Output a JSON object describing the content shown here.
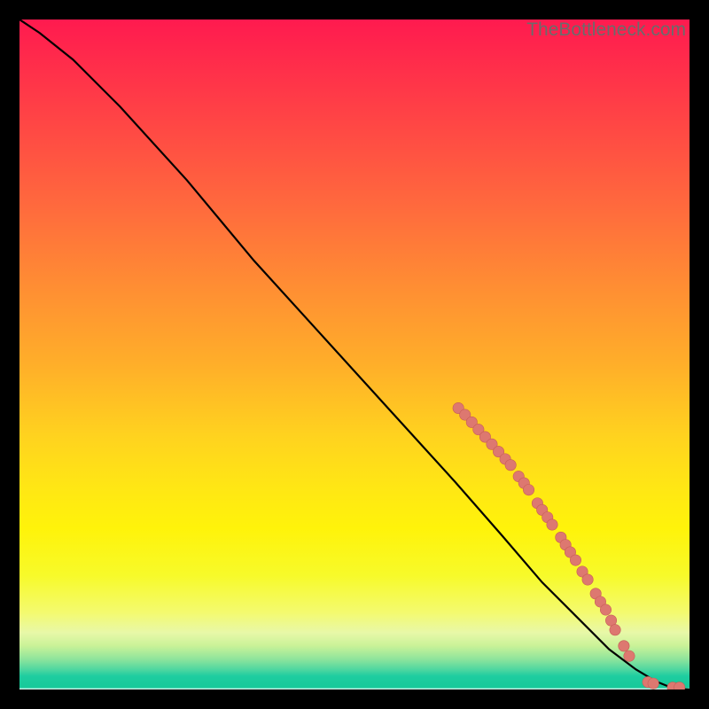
{
  "watermark": "TheBottleneck.com",
  "colors": {
    "background": "#000000",
    "curve": "#000000",
    "marker": "#dd7870",
    "marker_stroke": "#c75d56"
  },
  "chart_data": {
    "type": "line",
    "title": "",
    "xlabel": "",
    "ylabel": "",
    "xlim": [
      0,
      100
    ],
    "ylim": [
      0,
      100
    ],
    "series": [
      {
        "name": "curve",
        "x": [
          0,
          3,
          8,
          15,
          25,
          35,
          45,
          55,
          65,
          72,
          78,
          83,
          88,
          92,
          95,
          97,
          98.5,
          100
        ],
        "y": [
          100,
          98,
          94,
          87,
          76,
          64,
          53,
          42,
          31,
          23,
          16,
          11,
          6,
          3,
          1.2,
          0.4,
          0.1,
          0
        ]
      }
    ],
    "markers": [
      {
        "x": 65.5,
        "y": 42.0
      },
      {
        "x": 66.5,
        "y": 41.0
      },
      {
        "x": 67.5,
        "y": 39.9
      },
      {
        "x": 68.5,
        "y": 38.8
      },
      {
        "x": 69.5,
        "y": 37.7
      },
      {
        "x": 70.5,
        "y": 36.6
      },
      {
        "x": 71.5,
        "y": 35.5
      },
      {
        "x": 72.5,
        "y": 34.4
      },
      {
        "x": 73.3,
        "y": 33.5
      },
      {
        "x": 74.5,
        "y": 31.8
      },
      {
        "x": 75.3,
        "y": 30.8
      },
      {
        "x": 76.0,
        "y": 29.8
      },
      {
        "x": 77.3,
        "y": 27.8
      },
      {
        "x": 78.0,
        "y": 26.8
      },
      {
        "x": 78.8,
        "y": 25.7
      },
      {
        "x": 79.5,
        "y": 24.6
      },
      {
        "x": 80.8,
        "y": 22.7
      },
      {
        "x": 81.5,
        "y": 21.6
      },
      {
        "x": 82.2,
        "y": 20.5
      },
      {
        "x": 83.0,
        "y": 19.3
      },
      {
        "x": 84.0,
        "y": 17.6
      },
      {
        "x": 84.8,
        "y": 16.4
      },
      {
        "x": 86.0,
        "y": 14.3
      },
      {
        "x": 86.7,
        "y": 13.1
      },
      {
        "x": 87.5,
        "y": 11.9
      },
      {
        "x": 88.3,
        "y": 10.3
      },
      {
        "x": 88.9,
        "y": 8.9
      },
      {
        "x": 90.2,
        "y": 6.5
      },
      {
        "x": 91.0,
        "y": 5.0
      },
      {
        "x": 93.8,
        "y": 1.1
      },
      {
        "x": 94.6,
        "y": 0.9
      },
      {
        "x": 97.5,
        "y": 0.3
      },
      {
        "x": 98.5,
        "y": 0.3
      }
    ]
  }
}
